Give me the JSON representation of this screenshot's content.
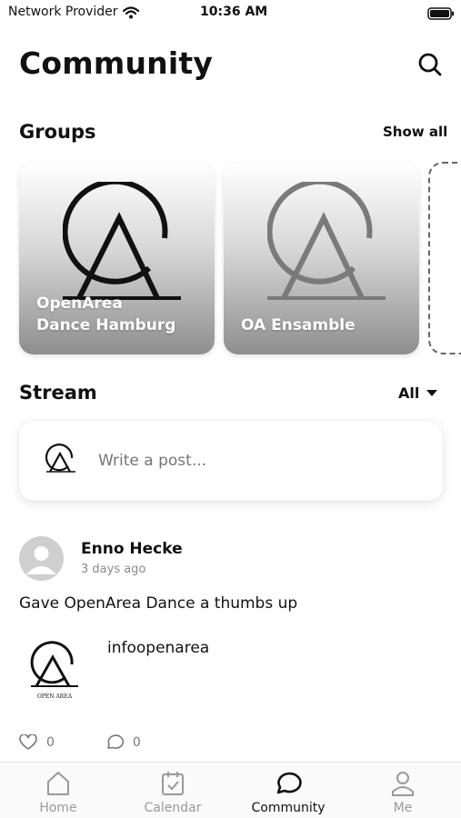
{
  "status_bar": {
    "carrier": "Network Provider",
    "time": "10:36 AM",
    "wifi_icon": "wifi-icon",
    "battery_icon": "battery-icon"
  },
  "header": {
    "title": "Community",
    "search_icon": "search-icon"
  },
  "groups": {
    "title": "Groups",
    "show_all_label": "Show all",
    "cards": [
      {
        "label": "OpenArea\nDance Hamburg",
        "icon": "openarea-logo"
      },
      {
        "label": "OA Ensamble",
        "icon": "openarea-logo"
      }
    ]
  },
  "stream": {
    "title": "Stream",
    "filter_label": "All",
    "composer_placeholder": "Write a post..."
  },
  "post": {
    "author": "Enno Hecke",
    "time": "3 days ago",
    "text_prefix": "Gave ",
    "text_link": "OpenArea Dance",
    "text_suffix": " a thumbs up",
    "attachment_name": "infoopenarea",
    "attachment_logo_caption": "OPEN AREA",
    "likes": "0",
    "comments": "0"
  },
  "tab_bar": {
    "tabs": [
      {
        "label": "Home",
        "icon": "home-icon"
      },
      {
        "label": "Calendar",
        "icon": "calendar-icon"
      },
      {
        "label": "Community",
        "icon": "chat-bubble-icon",
        "active": true
      },
      {
        "label": "Me",
        "icon": "person-icon"
      }
    ]
  },
  "colors": {
    "text": "#111111",
    "muted": "#8a8a8a",
    "tab_inactive": "#9a9a9a",
    "card_gradient_end": "#8e8e8e"
  }
}
